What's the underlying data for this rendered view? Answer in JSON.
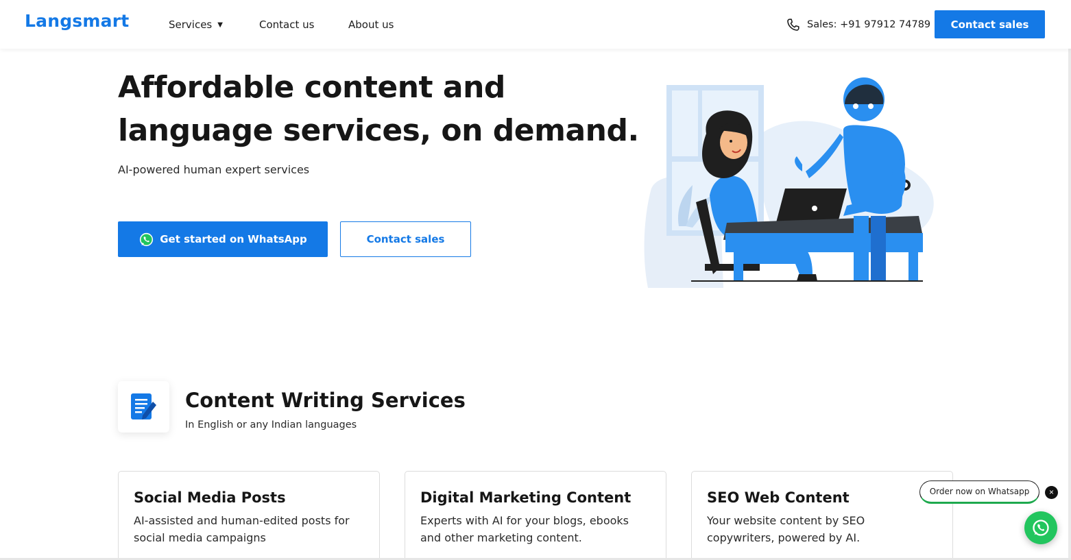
{
  "header": {
    "logo": "Langsmart",
    "nav": [
      {
        "label": "Services"
      },
      {
        "label": "Contact us"
      },
      {
        "label": "About us"
      }
    ],
    "phone": "Sales: +91 97912 74789",
    "cta_label": "Contact sales"
  },
  "hero": {
    "title_line1": "Affordable content and",
    "title_line2": "language services, on demand.",
    "subtitle": "AI-powered human expert services",
    "primary_button": "Get started on WhatsApp",
    "secondary_button": "Contact sales"
  },
  "section": {
    "title": "Content Writing Services",
    "subtitle": "In English or any Indian languages",
    "cards": [
      {
        "title": "Social Media Posts",
        "desc": "AI-assisted and human-edited posts for social media campaigns"
      },
      {
        "title": "Digital Marketing Content",
        "desc": "Experts with AI for your blogs, ebooks and other marketing content."
      },
      {
        "title": "SEO Web Content",
        "desc": "Your website content by SEO copywriters, powered by AI."
      }
    ]
  },
  "widget": {
    "order_label": "Order now on Whatsapp",
    "close_glyph": "×"
  },
  "colors": {
    "brand_blue": "#1479e6",
    "whatsapp_green": "#22c55e"
  },
  "icons": [
    "phone-icon",
    "whatsapp-icon",
    "document-icon",
    "close-icon"
  ]
}
